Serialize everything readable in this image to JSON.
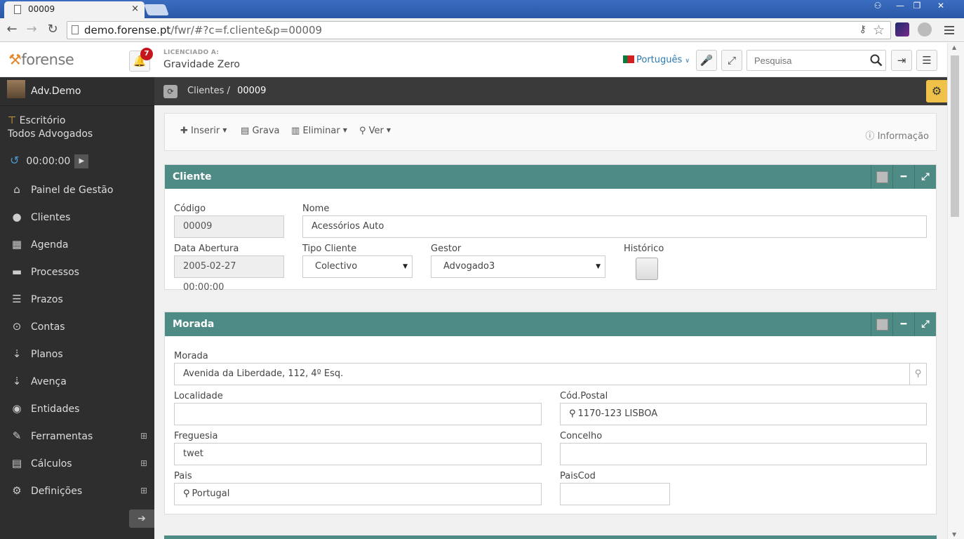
{
  "browser": {
    "tab_title": "00009",
    "tab_close": "×",
    "url_host": "demo.forense.pt",
    "url_path": "/fwr/#?c=f.cliente&p=00009",
    "window_buttons": [
      "⚇",
      "—",
      "❐",
      "✕"
    ]
  },
  "header": {
    "logo_text": "forense",
    "notification_count": "7",
    "license_label": "LICENCIADO A:",
    "license_name": "Gravidade Zero",
    "language": "Português",
    "search_placeholder": "Pesquisa"
  },
  "sidebar": {
    "user": "Adv.Demo",
    "office_line1": "Escritório",
    "office_line2": "Todos Advogados",
    "timer": "00:00:00",
    "items": [
      {
        "label": "Painel de Gestão",
        "icon": "home-icon",
        "glyph": "⌂"
      },
      {
        "label": "Clientes",
        "icon": "user-icon",
        "glyph": "●"
      },
      {
        "label": "Agenda",
        "icon": "calendar-icon",
        "glyph": "▦"
      },
      {
        "label": "Processos",
        "icon": "briefcase-icon",
        "glyph": "▬"
      },
      {
        "label": "Prazos",
        "icon": "tasks-icon",
        "glyph": "☰"
      },
      {
        "label": "Contas",
        "icon": "money-icon",
        "glyph": "⊙"
      },
      {
        "label": "Planos",
        "icon": "sort-numeric-icon",
        "glyph": "⇣"
      },
      {
        "label": "Avença",
        "icon": "sort-alpha-icon",
        "glyph": "⇣"
      },
      {
        "label": "Entidades",
        "icon": "users-icon",
        "glyph": "◉"
      },
      {
        "label": "Ferramentas",
        "icon": "wrench-icon",
        "glyph": "✎",
        "expand": "⊞"
      },
      {
        "label": "Cálculos",
        "icon": "calculator-icon",
        "glyph": "▤",
        "expand": "⊞"
      },
      {
        "label": "Definições",
        "icon": "cogs-icon",
        "glyph": "⚙",
        "expand": "⊞"
      }
    ]
  },
  "breadcrumb": {
    "parent": "Clientes",
    "separator": "/",
    "current": "00009"
  },
  "toolbar": {
    "insert": "Inserir",
    "save": "Grava",
    "delete": "Eliminar",
    "view": "Ver",
    "info": "Informação"
  },
  "cliente": {
    "title": "Cliente",
    "codigo_label": "Código",
    "codigo": "00009",
    "nome_label": "Nome",
    "nome": "Acessórios Auto",
    "data_label": "Data Abertura",
    "data": "2005-02-27 00:00:00",
    "tipo_label": "Tipo Cliente",
    "tipo": "Colectivo",
    "gestor_label": "Gestor",
    "gestor": "Advogado3",
    "historico_label": "Histórico"
  },
  "morada": {
    "title": "Morada",
    "morada_label": "Morada",
    "morada": "Avenida da Liberdade, 112, 4º Esq.",
    "localidade_label": "Localidade",
    "localidade": "",
    "codpostal_label": "Cód.Postal",
    "codpostal": "1170-123 LISBOA",
    "freguesia_label": "Freguesia",
    "freguesia": "twet",
    "concelho_label": "Concelho",
    "concelho": "",
    "pais_label": "Pais",
    "pais": "Portugal",
    "paiscod_label": "PaisCod",
    "paiscod": ""
  },
  "colors": {
    "panel_header": "#4e8b84",
    "sidebar": "#2e2e2e",
    "accent": "#f0c24a"
  }
}
